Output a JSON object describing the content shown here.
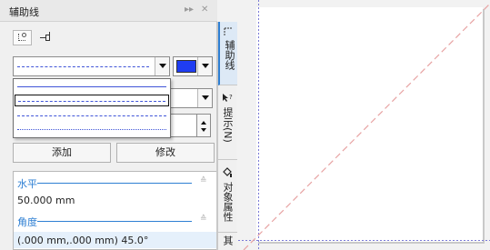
{
  "panel": {
    "title": "辅助线",
    "controls": {
      "pin": "▸▸",
      "close": "✕"
    }
  },
  "toolbar": {
    "preset_icon": "guideline-preset-icon",
    "snap_icon": "guideline-snap-icon"
  },
  "line_style": {
    "selected": "dashed",
    "options": [
      "solid",
      "long-dash",
      "short-dash",
      "dotted"
    ],
    "color": "#1f3df2"
  },
  "actions": {
    "add": "添加",
    "modify": "修改"
  },
  "guides_list": {
    "horizontal_label": "水平",
    "horizontal_value": "50.000 mm",
    "angle_label": "角度",
    "angle_value": "(.000 mm,.000 mm) 45.0°"
  },
  "side_tabs": [
    {
      "label": "辅助线",
      "icon": "guideline-icon"
    },
    {
      "label": "提示(N)",
      "icon": "help-cursor-icon"
    },
    {
      "label": "对象属性",
      "icon": "fill-icon"
    },
    {
      "label": "其",
      "icon": ""
    }
  ],
  "colors": {
    "accent": "#2e7fd3",
    "guide": "#7b7bd6",
    "diagonal_guide": "#e7a2a2"
  }
}
